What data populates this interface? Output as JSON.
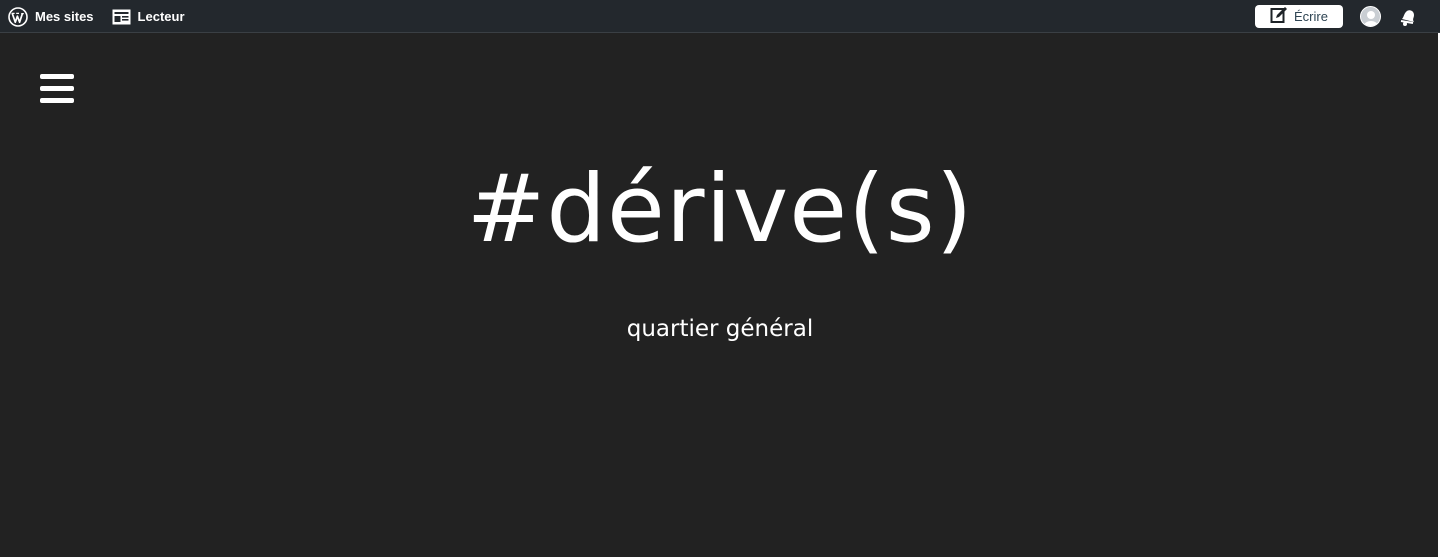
{
  "topbar": {
    "my_sites_label": "Mes sites",
    "reader_label": "Lecteur",
    "write_label": "Écrire",
    "icons": {
      "wordpress": "wordpress-logo-icon",
      "reader": "reader-icon",
      "write": "edit-icon",
      "avatar": "avatar",
      "notifications": "bell-icon"
    }
  },
  "site": {
    "title": "#dérive(s)",
    "description": "quartier général"
  },
  "colors": {
    "background": "#222222",
    "topbar": "#23282d",
    "text": "#ffffff"
  }
}
